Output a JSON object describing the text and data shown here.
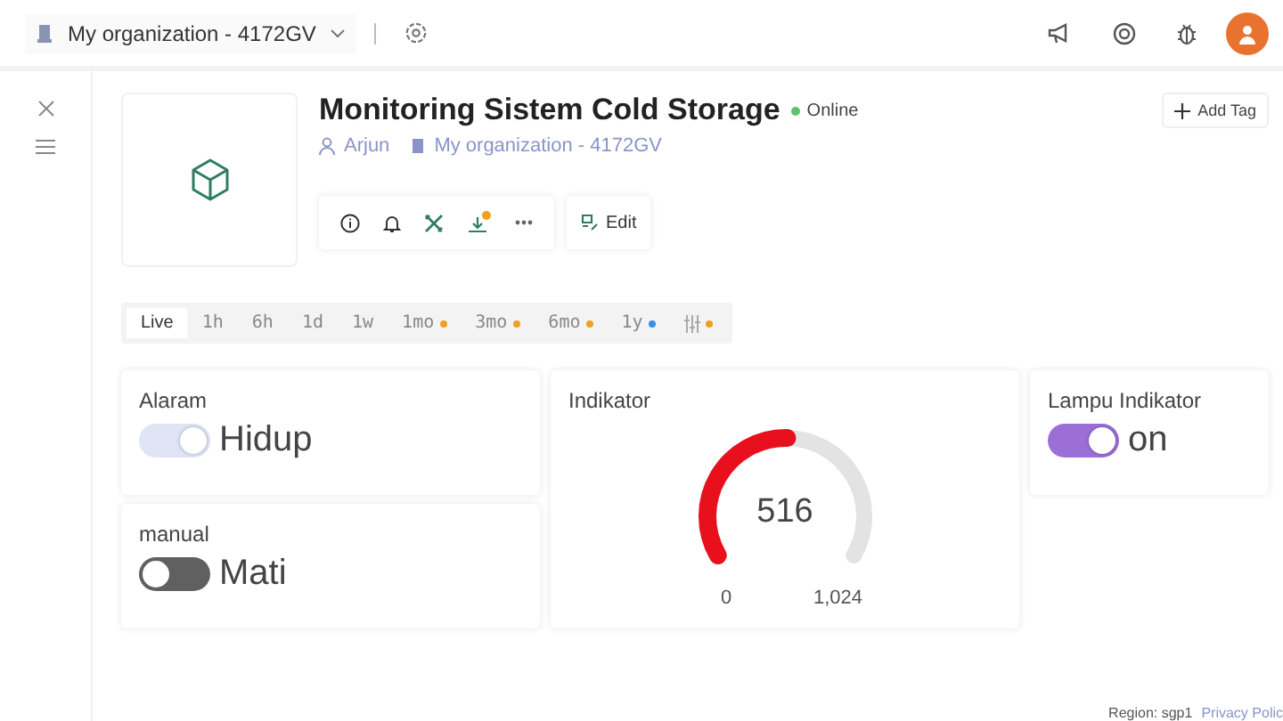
{
  "topbar": {
    "organization": "My organization - 4172GV"
  },
  "device": {
    "title": "Monitoring Sistem Cold Storage",
    "status": "Online",
    "owner": "Arjun",
    "organization": "My organization - 4172GV",
    "edit_label": "Edit",
    "add_tag_label": "Add Tag"
  },
  "range_tabs": [
    {
      "label": "Live",
      "selected": true
    },
    {
      "label": "1h",
      "selected": false
    },
    {
      "label": "6h",
      "selected": false
    },
    {
      "label": "1d",
      "selected": false
    },
    {
      "label": "1w",
      "selected": false
    },
    {
      "label": "1mo",
      "selected": false,
      "color": "#f0a020"
    },
    {
      "label": "3mo",
      "selected": false,
      "color": "#f0a020"
    },
    {
      "label": "6mo",
      "selected": false,
      "color": "#f0a020"
    },
    {
      "label": "1y",
      "selected": false,
      "color": "#3a8ee6"
    },
    {
      "kind": "filter",
      "selected": false,
      "color": "#f0a020"
    }
  ],
  "widgets": [
    {
      "kind": "switch",
      "title": "Alaram",
      "on": true,
      "value": "Hidup",
      "color": "#dfe5f5"
    },
    {
      "kind": "gauge",
      "title": "Indikator",
      "value": "516",
      "min": "0",
      "max": "1,024",
      "level": 0.504
    },
    {
      "kind": "switch",
      "title": "Lampu Indikator",
      "on": true,
      "value": "on",
      "color": "#9b6fd6"
    },
    {
      "kind": "switch",
      "title": "manual",
      "on": false,
      "value": "Mati",
      "color": "#606060"
    }
  ],
  "footer": {
    "region": "Region: sgp1",
    "privacy": "Privacy Polic"
  }
}
